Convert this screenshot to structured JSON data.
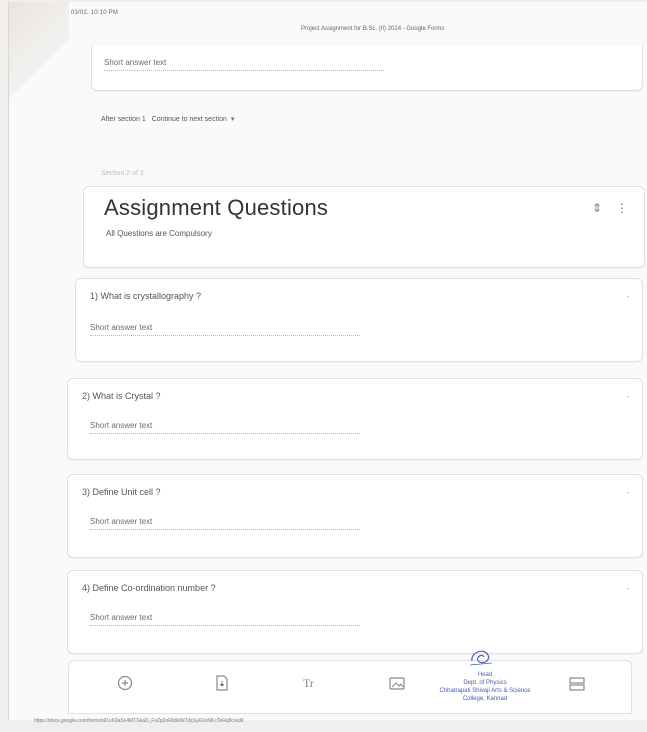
{
  "print_header": {
    "datetime": "03/02, 10:10 PM",
    "doc_title": "Project Assignment for B.Sc. (II) 2024 - Google Forms"
  },
  "prev_question": {
    "placeholder": "Short answer text"
  },
  "after_section": {
    "label": "After section 1",
    "value": "Continue to next section"
  },
  "section_label": "Section 2 of 2",
  "section": {
    "title": "Assignment Questions",
    "description": "All Questions are Compulsory"
  },
  "questions": [
    {
      "text": "1) What is crystallography ?",
      "placeholder": "Short answer text"
    },
    {
      "text": "2) What is Crystal ?",
      "placeholder": "Short answer text"
    },
    {
      "text": "3) Define Unit cell ?",
      "placeholder": "Short answer text"
    },
    {
      "text": "4) Define Co-ordination number ?",
      "placeholder": "Short answer text"
    }
  ],
  "toolbar": {
    "icons": [
      "add-question-icon",
      "import-questions-icon",
      "add-title-icon",
      "add-image-icon",
      "add-section-icon"
    ],
    "title_glyph": "Tr"
  },
  "stamp": {
    "line1": "Head",
    "line2": "Dept. of Physics",
    "line3": "Chhatrapati Shivaji Arts & Science",
    "line4": "College, Kannad"
  },
  "footer": {
    "url": "https://docs.google.com/forms/d/1xK9aSx4MTSkaD_FvZp0nRb9kW7dsSyR2vNKcTeRq8c/edit"
  },
  "colors": {
    "stamp_ink": "#4a5db0",
    "paper": "#fbfaf9"
  }
}
